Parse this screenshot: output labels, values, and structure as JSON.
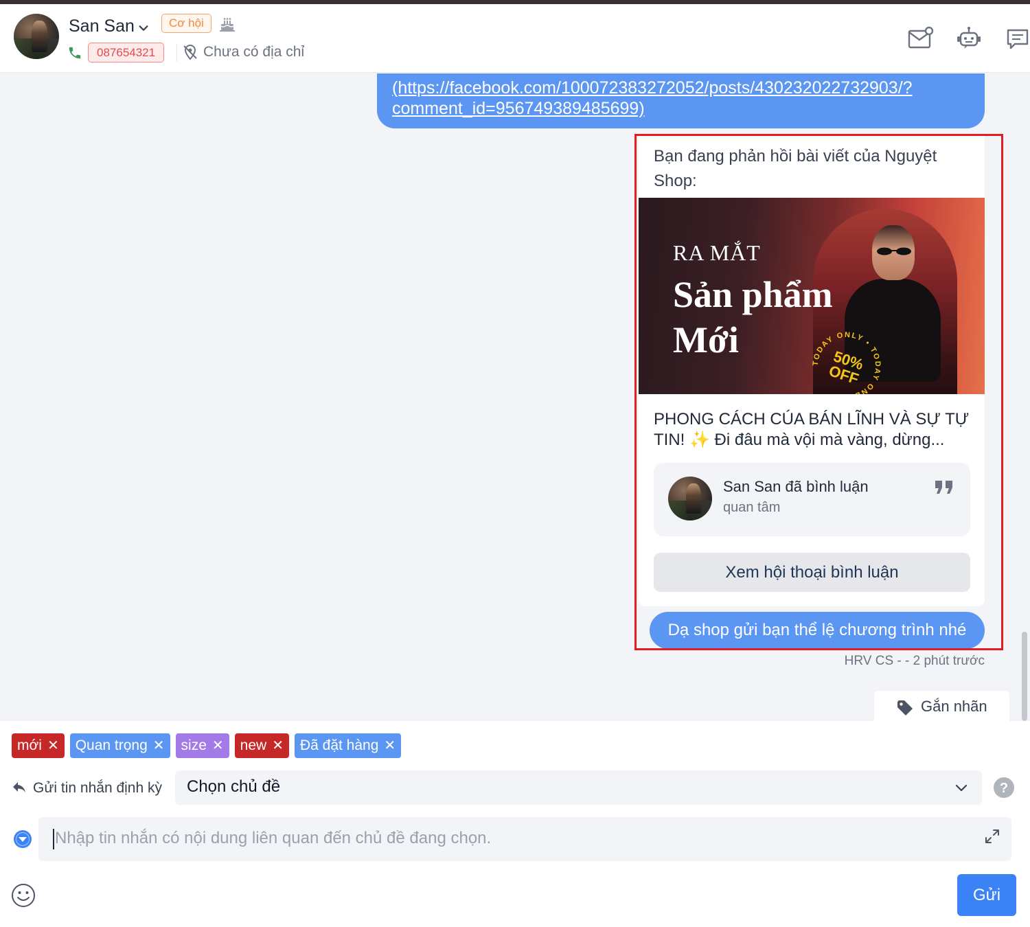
{
  "header": {
    "customer_name": "San San",
    "status_badge": "Cơ hội",
    "phone": "087654321",
    "address": "Chưa có địa chỉ",
    "icons": [
      "mail-icon",
      "bot-icon",
      "notes-icon",
      "cake-icon",
      "phone-icon",
      "no-location-icon"
    ]
  },
  "chat": {
    "link_text": "(https://facebook.com/100072383272052/posts/430232022732903/?comment_id=956749389485699)",
    "reply_card": {
      "intro": "Bạn đang phản hồi bài viết của Nguyệt Shop:",
      "banner": {
        "line1": "RA MẮT",
        "line2": "Sản phẩm",
        "line3": "Mới",
        "stamp_ring": "TODAY ONLY • TODAY ONLY •",
        "stamp_line1": "50%",
        "stamp_line2": "OFF"
      },
      "post_text": "PHONG CÁCH CÚA BÁN LĨNH VÀ SỰ TỰ TIN! ✨ Đi đâu mà vội mà vàng, dừng...",
      "comment_author": "San San đã bình luận",
      "comment_text": "quan tâm",
      "view_conversation_button": "Xem hội thoại bình luận"
    },
    "message": "Dạ shop gửi bạn thể lệ chương trình nhé",
    "message_meta": "HRV CS - - 2 phút trước",
    "tag_button": "Gắn nhãn"
  },
  "composer": {
    "tags": [
      {
        "label": "mới",
        "color": "#c62828"
      },
      {
        "label": "Quan trọng",
        "color": "#5b96f2"
      },
      {
        "label": "size",
        "color": "#a27be8"
      },
      {
        "label": "new",
        "color": "#c62828"
      },
      {
        "label": "Đã đặt hàng",
        "color": "#5b96f2"
      }
    ],
    "schedule_label": "Gửi tin nhắn định kỳ",
    "topic_select_value": "Chọn chủ đề",
    "input_placeholder": "Nhập tin nhắn có nội dung liên quan đến chủ đề đang chọn.",
    "send_button": "Gửi"
  },
  "colors": {
    "accent_blue": "#5b96f2",
    "send_blue": "#3b82f6",
    "highlight_red": "#e31b23",
    "opportunity_orange": "#f08a3c",
    "phone_red": "#e24b4b"
  }
}
